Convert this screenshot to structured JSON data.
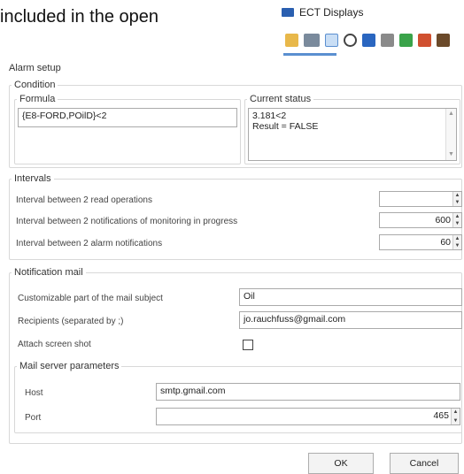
{
  "doc_text": "included in the open",
  "app": {
    "title": "ECT Displays"
  },
  "toolbar": {
    "icons": [
      "open-folder-icon",
      "new-document-icon",
      "selected-display-icon",
      "clock-icon",
      "blue-book-icon",
      "print-icon",
      "green-chart-icon",
      "lock-icon",
      "brown-tool-icon"
    ]
  },
  "dialog": {
    "title": "Alarm setup",
    "condition": {
      "legend": "Condition",
      "formula_label": "Formula",
      "formula_value": "{E8-FORD,POilD}<2",
      "status_label": "Current status",
      "status_line1": "3.181<2",
      "status_line2": "Result = FALSE"
    },
    "intervals": {
      "legend": "Intervals",
      "read_label": "Interval between 2 read operations",
      "read_value": "",
      "monitoring_label": "Interval between 2 notifications of monitoring in progress",
      "monitoring_value": "600",
      "alarm_label": "Interval between 2 alarm notifications",
      "alarm_value": "60"
    },
    "mail": {
      "legend": "Notification mail",
      "subject_label": "Customizable part of the mail subject",
      "subject_value": "Oil",
      "recipients_label": "Recipients (separated by ;)",
      "recipients_value": "jo.rauchfuss@gmail.com",
      "attach_label": "Attach screen shot",
      "attach_checked": false,
      "server": {
        "legend": "Mail server parameters",
        "host_label": "Host",
        "host_value": "smtp.gmail.com",
        "port_label": "Port",
        "port_value": "465"
      }
    },
    "buttons": {
      "ok": "OK",
      "cancel": "Cancel"
    }
  }
}
